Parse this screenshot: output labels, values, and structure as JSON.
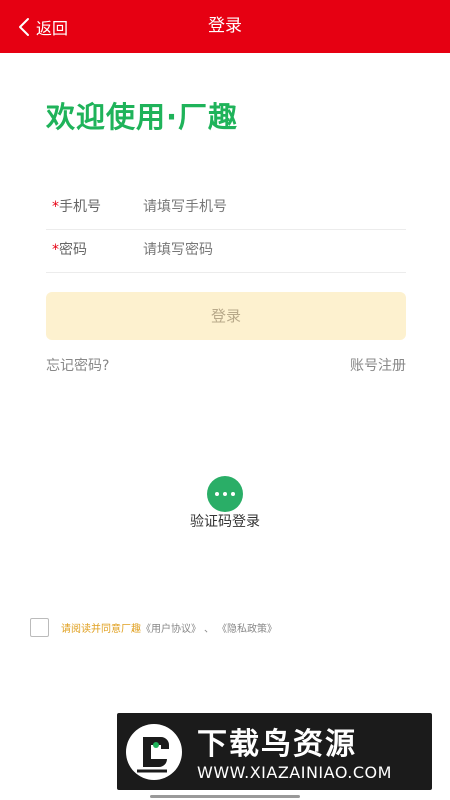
{
  "header": {
    "back_label": "返回",
    "title": "登录"
  },
  "welcome": "欢迎使用·厂趣",
  "form": {
    "required_mark": "*",
    "phone_label": "手机号",
    "phone_placeholder": "请填写手机号",
    "password_label": "密码",
    "password_placeholder": "请填写密码",
    "login_label": "登录"
  },
  "links": {
    "forgot": "忘记密码?",
    "register": "账号注册"
  },
  "sms_login": {
    "icon": "more-dots-icon",
    "label": "验证码登录"
  },
  "agreement": {
    "text": "请阅读并同意厂趣",
    "user_agreement": "《用户协议》",
    "separator": "、",
    "privacy_policy": "《隐私政策》"
  },
  "watermark": {
    "title": "下载鸟资源",
    "url": "WWW.XIAZAINIAO.COM"
  },
  "colors": {
    "brand_red": "#e60012",
    "welcome_green": "#1fb35a",
    "button_bg": "#fdf1cf",
    "sms_green": "#2aae67",
    "agree_orange": "#e0a020"
  }
}
